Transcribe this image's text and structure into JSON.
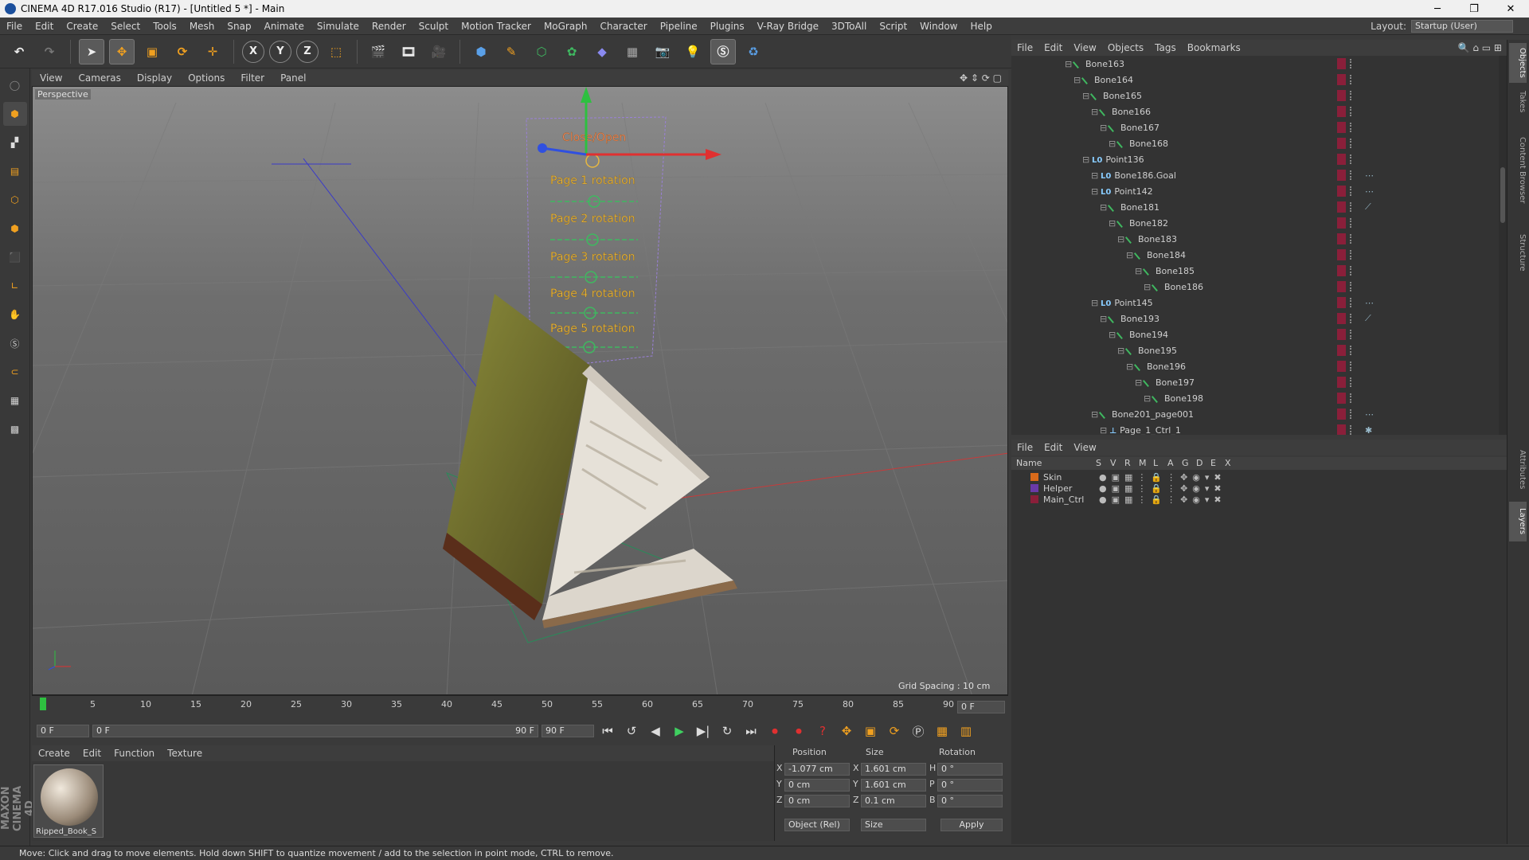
{
  "window": {
    "title": "CINEMA 4D R17.016 Studio (R17) - [Untitled 5 *] - Main",
    "min": "─",
    "max": "❐",
    "close": "✕"
  },
  "menubar": {
    "items": [
      "File",
      "Edit",
      "Create",
      "Select",
      "Tools",
      "Mesh",
      "Snap",
      "Animate",
      "Simulate",
      "Render",
      "Sculpt",
      "Motion Tracker",
      "MoGraph",
      "Character",
      "Pipeline",
      "Plugins",
      "V-Ray Bridge",
      "3DToAll",
      "Script",
      "Window",
      "Help"
    ],
    "layout_label": "Layout:",
    "layout_value": "Startup (User)"
  },
  "toolbar": {
    "x_label": "X",
    "y_label": "Y",
    "z_label": "Z"
  },
  "viewport": {
    "menu": [
      "View",
      "Cameras",
      "Display",
      "Options",
      "Filter",
      "Panel"
    ],
    "label": "Perspective",
    "grid_spacing": "Grid Spacing : 10 cm",
    "controls": [
      "Close/Open",
      "Page 1 rotation",
      "Page 2 rotation",
      "Page 3 rotation",
      "Page 4 rotation",
      "Page 5 rotation"
    ]
  },
  "timeline": {
    "ticks": [
      "0",
      "5",
      "10",
      "15",
      "20",
      "25",
      "30",
      "35",
      "40",
      "45",
      "50",
      "55",
      "60",
      "65",
      "70",
      "75",
      "80",
      "85",
      "90"
    ],
    "current_frame": "0 F",
    "start_field": "0 F",
    "range_start": "0 F",
    "range_end": "90 F",
    "end_field": "90 F"
  },
  "material_manager": {
    "menu": [
      "Create",
      "Edit",
      "Function",
      "Texture"
    ],
    "material_name": "Ripped_Book_S"
  },
  "coordinates": {
    "headers": [
      "Position",
      "Size",
      "Rotation"
    ],
    "rows": [
      {
        "axis": "X",
        "pos": "-1.077 cm",
        "size_axis": "X",
        "size": "1.601 cm",
        "rot_axis": "H",
        "rot": "0 °"
      },
      {
        "axis": "Y",
        "pos": "0 cm",
        "size_axis": "Y",
        "size": "1.601 cm",
        "rot_axis": "P",
        "rot": "0 °"
      },
      {
        "axis": "Z",
        "pos": "0 cm",
        "size_axis": "Z",
        "size": "0.1 cm",
        "rot_axis": "B",
        "rot": "0 °"
      }
    ],
    "mode": "Object (Rel)",
    "size_mode": "Size",
    "apply": "Apply"
  },
  "object_manager": {
    "menu": [
      "File",
      "Edit",
      "View",
      "Objects",
      "Tags",
      "Bookmarks"
    ],
    "rows": [
      {
        "name": "Bone163",
        "depth": 7,
        "kind": "bone"
      },
      {
        "name": "Bone164",
        "depth": 8,
        "kind": "bone"
      },
      {
        "name": "Bone165",
        "depth": 9,
        "kind": "bone"
      },
      {
        "name": "Bone166",
        "depth": 10,
        "kind": "bone"
      },
      {
        "name": "Bone167",
        "depth": 11,
        "kind": "bone"
      },
      {
        "name": "Bone168",
        "depth": 12,
        "kind": "bone"
      },
      {
        "name": "Point136",
        "depth": 9,
        "kind": "point"
      },
      {
        "name": "Bone186.Goal",
        "depth": 10,
        "kind": "point",
        "tag": "⋯"
      },
      {
        "name": "Point142",
        "depth": 10,
        "kind": "point",
        "tag": "⋯"
      },
      {
        "name": "Bone181",
        "depth": 11,
        "kind": "bone",
        "tag": "⟋"
      },
      {
        "name": "Bone182",
        "depth": 12,
        "kind": "bone"
      },
      {
        "name": "Bone183",
        "depth": 13,
        "kind": "bone"
      },
      {
        "name": "Bone184",
        "depth": 14,
        "kind": "bone"
      },
      {
        "name": "Bone185",
        "depth": 15,
        "kind": "bone"
      },
      {
        "name": "Bone186",
        "depth": 16,
        "kind": "bone"
      },
      {
        "name": "Point145",
        "depth": 10,
        "kind": "point",
        "tag": "⋯"
      },
      {
        "name": "Bone193",
        "depth": 11,
        "kind": "bone",
        "tag": "⟋"
      },
      {
        "name": "Bone194",
        "depth": 12,
        "kind": "bone"
      },
      {
        "name": "Bone195",
        "depth": 13,
        "kind": "bone"
      },
      {
        "name": "Bone196",
        "depth": 14,
        "kind": "bone"
      },
      {
        "name": "Bone197",
        "depth": 15,
        "kind": "bone"
      },
      {
        "name": "Bone198",
        "depth": 16,
        "kind": "bone"
      },
      {
        "name": "Bone201_page001",
        "depth": 10,
        "kind": "bone",
        "tag": "⋯"
      },
      {
        "name": "Page_1_Ctrl_1",
        "depth": 11,
        "kind": "ctrl",
        "tag": "✱"
      }
    ]
  },
  "layer_manager": {
    "menu": [
      "File",
      "Edit",
      "View"
    ],
    "headers": [
      "Name",
      "S",
      "V",
      "R",
      "M",
      "L",
      "A",
      "G",
      "D",
      "E",
      "X"
    ],
    "layers": [
      {
        "name": "Skin",
        "color": "#d86a1a"
      },
      {
        "name": "Helper",
        "color": "#6a3aa8"
      },
      {
        "name": "Main_Ctrl",
        "color": "#8a1f3a"
      }
    ]
  },
  "side_tabs": [
    "Objects",
    "Takes",
    "Content Browser",
    "Structure",
    "Attributes",
    "Layers"
  ],
  "branding": "MAXON CINEMA 4D",
  "status": "Move: Click and drag to move elements. Hold down SHIFT to quantize movement / add to the selection in point mode, CTRL to remove."
}
